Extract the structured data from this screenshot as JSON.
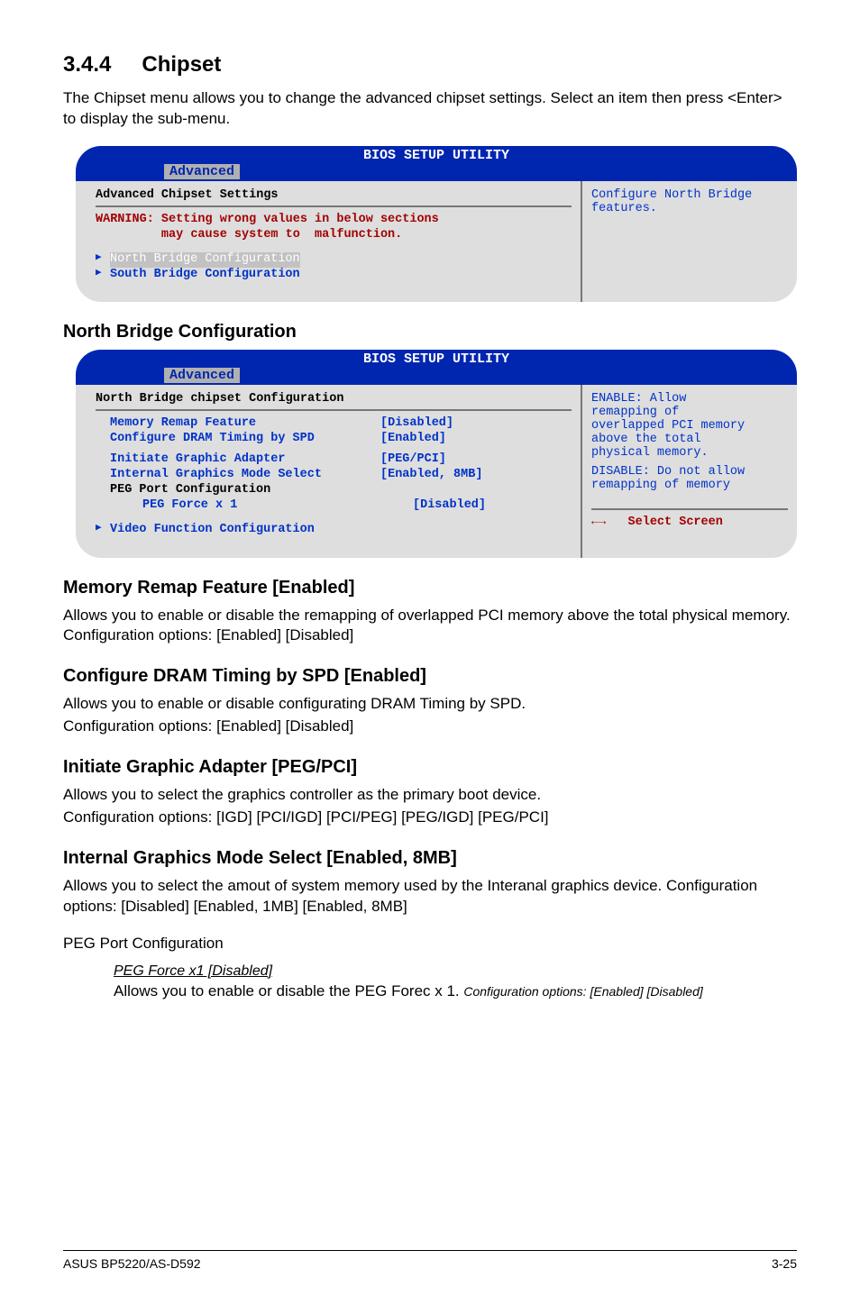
{
  "section": {
    "number": "3.4.4",
    "title": "Chipset"
  },
  "intro": "The Chipset menu allows you to change the advanced chipset settings. Select an item then press <Enter> to display the sub-menu.",
  "bios1": {
    "title": "BIOS SETUP UTILITY",
    "tab": "Advanced",
    "heading": "Advanced Chipset Settings",
    "warning_l1": "WARNING: Setting wrong values in below sections",
    "warning_l2": "         may cause system to  malfunction.",
    "item1": "North Bridge Configuration",
    "item2": "South Bridge Configuration",
    "help": "Configure North Bridge features."
  },
  "nbc_heading": "North Bridge Configuration",
  "bios2": {
    "title": "BIOS SETUP UTILITY",
    "tab": "Advanced",
    "heading": "North Bridge chipset Configuration",
    "rows": {
      "r1": {
        "label": "Memory Remap Feature",
        "value": "[Disabled]"
      },
      "r2": {
        "label": "Configure DRAM Timing by SPD",
        "value": "[Enabled]"
      },
      "r3": {
        "label": "Initiate Graphic Adapter",
        "value": "[PEG/PCI]"
      },
      "r4": {
        "label": "Internal Graphics Mode Select",
        "value": "[Enabled, 8MB]"
      },
      "peg_hdr": "PEG Port Configuration",
      "r5": {
        "label": "PEG Force x 1",
        "value": "[Disabled]"
      }
    },
    "item_vfc": "Video Function Configuration",
    "help_lines": {
      "l1": "ENABLE: Allow",
      "l2": "remapping of",
      "l3": "overlapped PCI memory",
      "l4": "above the total",
      "l5": "physical memory.",
      "l6": "DISABLE: Do not allow",
      "l7": "remapping of memory"
    },
    "nav_arrow": "←→",
    "nav_text": "Select Screen"
  },
  "mrf": {
    "heading": "Memory Remap Feature [Enabled]",
    "body": "Allows you to enable or disable the  remapping of overlapped PCI memory above the total physical memory. Configuration options: [Enabled] [Disabled]"
  },
  "dram": {
    "heading": "Configure DRAM Timing by SPD [Enabled]",
    "body1": "Allows you to enable or disable configurating DRAM Timing by SPD.",
    "body2": "Configuration options: [Enabled] [Disabled]"
  },
  "iga": {
    "heading": "Initiate Graphic Adapter [PEG/PCI]",
    "body1": "Allows you to select the graphics controller as the primary boot device.",
    "body2": "Configuration options: [IGD] [PCI/IGD] [PCI/PEG] [PEG/IGD] [PEG/PCI]"
  },
  "igms": {
    "heading": "Internal Graphics Mode Select [Enabled, 8MB]",
    "body": "Allows you to select the amout of system memory used by the Interanal graphics device. Configuration options: [Disabled] [Enabled, 1MB] [Enabled, 8MB]"
  },
  "pegport": {
    "heading": "PEG Port Configuration",
    "sub_heading": "PEG Force x1 [Disabled]",
    "body_pre": "Allows you to enable or disable the PEG Forec x 1. ",
    "body_it": "Configuration options: [Enabled] [Disabled]"
  },
  "footer": {
    "left": "ASUS BP5220/AS-D592",
    "right": "3-25"
  }
}
